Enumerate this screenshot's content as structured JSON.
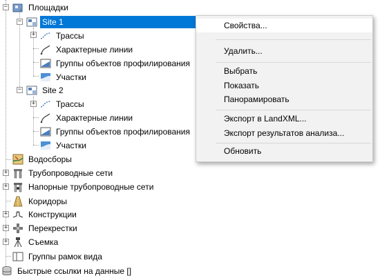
{
  "tree": {
    "sites_label": "Площадки",
    "site1": {
      "label": "Site 1",
      "alignments": "Трассы",
      "feature_lines": "Характерные линии",
      "grading_groups": "Группы объектов профилирования",
      "parcels": "Участки"
    },
    "site2": {
      "label": "Site 2",
      "alignments": "Трассы",
      "feature_lines": "Характерные линии",
      "grading_groups": "Группы объектов профилирования",
      "parcels": "Участки"
    },
    "catchments": "Водосборы",
    "pipe_networks": "Трубопроводные сети",
    "pressure_networks": "Напорные трубопроводные сети",
    "corridors": "Коридоры",
    "assemblies": "Конструкции",
    "intersections": "Перекрестки",
    "survey": "Съемка",
    "view_frame_groups": "Группы рамок вида",
    "data_shortcuts": "Быстрые ссылки на данные []"
  },
  "context_menu": {
    "properties": "Свойства...",
    "delete": "Удалить...",
    "select": "Выбрать",
    "show": "Показать",
    "pan": "Панорамировать",
    "export_landxml": "Экспорт в LandXML...",
    "export_analysis": "Экспорт результатов анализа...",
    "refresh": "Обновить"
  },
  "colors": {
    "selection": "#0078d7",
    "menu_bg": "#f2f2f2"
  }
}
